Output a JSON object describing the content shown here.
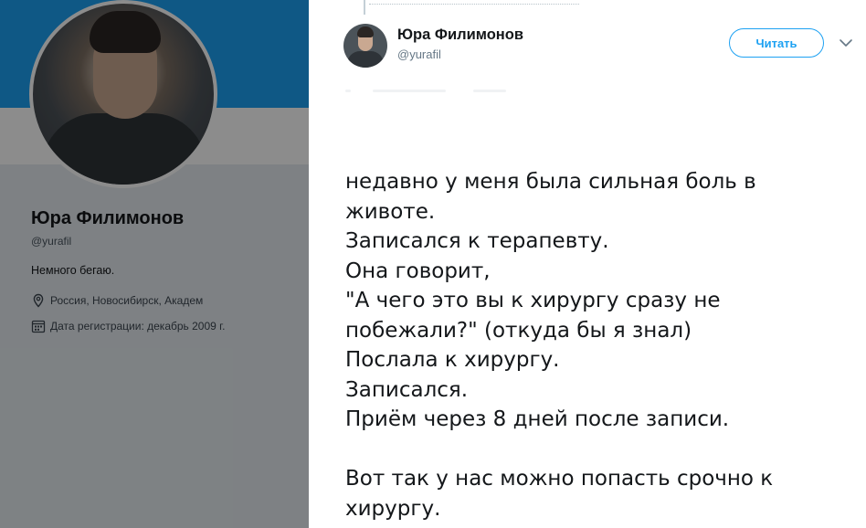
{
  "profile": {
    "name": "Юра Филимонов",
    "handle": "@yurafil",
    "bio": "Немного бегаю.",
    "location": "Россия, Новосибирск, Академ",
    "joined": "Дата регистрации: декабрь 2009 г."
  },
  "tweet": {
    "author_name": "Юра Филимонов",
    "author_handle": "@yurafil",
    "follow_label": "Читать",
    "text": "недавно у меня была сильная боль в\nживоте.\nЗаписался к терапевту.\nОна говорит,\n\"А чего это вы к хирургу сразу не\nпобежали?\" (откуда бы я знал)\nПослала к хирургу.\nЗаписался.\nПриём через 8 дней после записи.\n\nВот так у нас можно попасть срочно к\nхирургу."
  },
  "colors": {
    "accent": "#1da1f2",
    "text": "#14171a",
    "muted": "#657786"
  },
  "icons": {
    "location": "location-pin-icon",
    "joined": "calendar-icon",
    "caret": "chevron-down-icon"
  }
}
